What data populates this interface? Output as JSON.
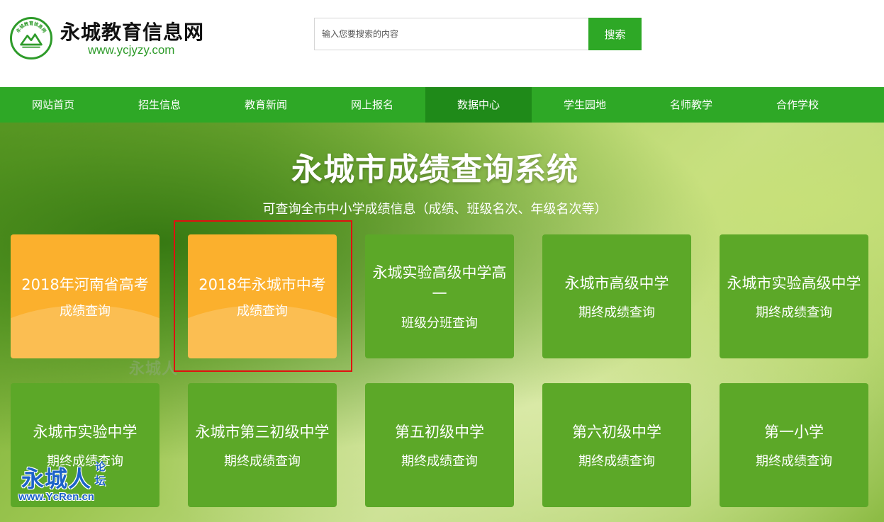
{
  "site": {
    "logo_badge_text": "永城教育信息网",
    "title": "永城教育信息网",
    "url": "www.ycjyzy.com"
  },
  "search": {
    "placeholder": "输入您要搜索的内容",
    "button_label": "搜索"
  },
  "nav": {
    "active_index": 4,
    "items": [
      {
        "label": "网站首页"
      },
      {
        "label": "招生信息"
      },
      {
        "label": "教育新闻"
      },
      {
        "label": "网上报名"
      },
      {
        "label": "数据中心"
      },
      {
        "label": "学生园地"
      },
      {
        "label": "名师教学"
      },
      {
        "label": "合作学校"
      }
    ]
  },
  "banner": {
    "title": "永城市成绩查询系统",
    "subtitle": "可查询全市中小学成绩信息（成绩、班级名次、年级名次等）"
  },
  "colors": {
    "primary_green": "#2ea826",
    "nav_active": "#1f8a19",
    "card_green": "#5ca828",
    "card_orange": "#fbb02d",
    "highlight_red": "#e01010"
  },
  "cards": [
    {
      "title": "2018年河南省高考",
      "subtitle": "成绩查询",
      "style": "orange"
    },
    {
      "title": "2018年永城市中考",
      "subtitle": "成绩查询",
      "style": "orange",
      "highlighted": true
    },
    {
      "title": "永城实验高级中学高一",
      "subtitle": "班级分班查询",
      "style": "green"
    },
    {
      "title": "永城市高级中学",
      "subtitle": "期终成绩查询",
      "style": "green"
    },
    {
      "title": "永城市实验高级中学",
      "subtitle": "期终成绩查询",
      "style": "green"
    },
    {
      "title": "永城市实验中学",
      "subtitle": "期终成绩查询",
      "style": "green"
    },
    {
      "title": "永城市第三初级中学",
      "subtitle": "期终成绩查询",
      "style": "green"
    },
    {
      "title": "第五初级中学",
      "subtitle": "期终成绩查询",
      "style": "green"
    },
    {
      "title": "第六初级中学",
      "subtitle": "期终成绩查询",
      "style": "green"
    },
    {
      "title": "第一小学",
      "subtitle": "期终成绩查询",
      "style": "green"
    }
  ],
  "watermarks": {
    "mid_text": "永城人",
    "logo_text": "永城人",
    "logo_small": "论坛",
    "logo_url": "www.YcRen.cn"
  }
}
